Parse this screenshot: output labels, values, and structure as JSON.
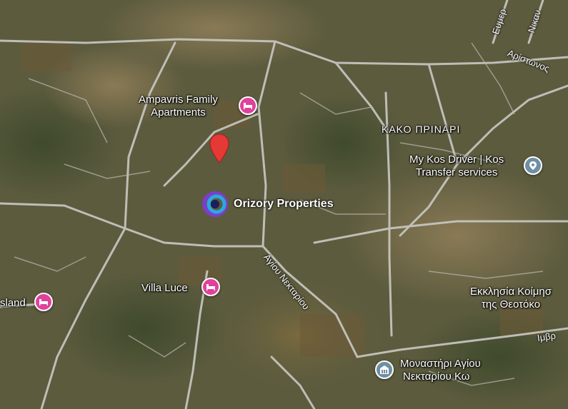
{
  "map": {
    "area_label": "ΚΑΚΟ ΠΡΙΝΑΡΙ",
    "places": [
      {
        "id": "ampavris",
        "name_line1": "Ampavris Family",
        "name_line2": "Apartments",
        "icon": "hotel-icon",
        "color": "#e0419b"
      },
      {
        "id": "villa-luce",
        "name_line1": "Villa Luce",
        "icon": "hotel-icon",
        "color": "#e0419b"
      },
      {
        "id": "island",
        "name_line1": "sland",
        "icon": "hotel-icon",
        "color": "#e0419b"
      },
      {
        "id": "kos-driver",
        "name_line1": "My Kos Driver | Kos",
        "name_line2": "Transfer services",
        "icon": "location-pin-icon",
        "color": "#6f8fa3"
      },
      {
        "id": "church",
        "name_line1": "Εκκλησία Κοίμησ",
        "name_line2": "της Θεοτόκο"
      },
      {
        "id": "monastery",
        "name_line1": "Μοναστήρι Αγίου",
        "name_line2": "Νεκταρίου Κω",
        "icon": "monastery-icon",
        "color": "#6f8fa3"
      }
    ],
    "streets": [
      {
        "id": "agiou-nektariou",
        "name": "Αγίου Νεκταρίου"
      },
      {
        "id": "aristonos",
        "name": "Αρίστωνος"
      },
      {
        "id": "evmer",
        "name": "Ευμερ"
      },
      {
        "id": "nikan",
        "name": "Νικαν"
      },
      {
        "id": "imvr",
        "name": "Ιμβρ"
      }
    ],
    "business": {
      "name": "Orizory Properties",
      "logo": "orizory-logo-icon"
    },
    "marker": {
      "icon": "red-map-pin-icon",
      "color": "#e53935"
    },
    "colors": {
      "hotel": "#e0419b",
      "poi": "#6f8fa3",
      "road": "#c9c9c4",
      "terrain": "#5b5a3c"
    }
  }
}
